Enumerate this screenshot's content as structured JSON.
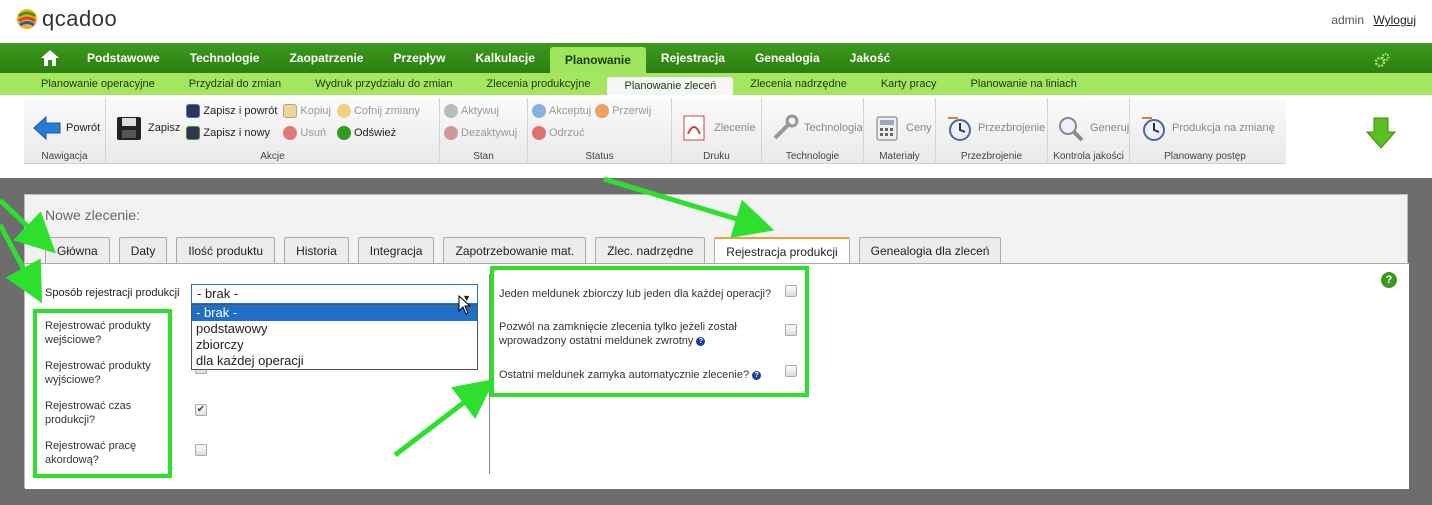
{
  "app": {
    "logo_text": "qcadoo",
    "user": "admin",
    "logout": "Wyloguj"
  },
  "main_menu": [
    "Podstawowe",
    "Technologie",
    "Zaopatrzenie",
    "Przepływ",
    "Kalkulacje",
    "Planowanie",
    "Rejestracja",
    "Genealogia",
    "Jakość"
  ],
  "main_menu_active": "Planowanie",
  "sub_menu": [
    "Planowanie operacyjne",
    "Przydział do zmian",
    "Wydruk przydziału do zmian",
    "Zlecenia produkcyjne",
    "Planowanie zleceń",
    "Zlecenia nadrzędne",
    "Karty pracy",
    "Planowanie na liniach"
  ],
  "sub_menu_active": "Planowanie zleceń",
  "ribbon": {
    "nav": {
      "back": "Powrót",
      "label": "Nawigacja"
    },
    "actions": {
      "save": "Zapisz",
      "save_back": "Zapisz i powrót",
      "save_new": "Zapisz i nowy",
      "copy": "Kopiuj",
      "delete": "Usuń",
      "undo": "Cofnij zmiany",
      "refresh": "Odśwież",
      "label": "Akcje"
    },
    "state": {
      "activate": "Aktywuj",
      "deactivate": "Dezaktywuj",
      "label": "Stan"
    },
    "status": {
      "accept": "Akceptuj",
      "interrupt": "Przerwij",
      "reject": "Odrzuć",
      "label": "Status"
    },
    "print": {
      "order": "Zlecenie",
      "label": "Druku"
    },
    "technology": {
      "btn": "Technologia",
      "label": "Technologie"
    },
    "materials": {
      "btn": "Ceny",
      "label": "Materiały"
    },
    "changeover": {
      "btn": "Przezbrojenie",
      "label": "Przezbrojenie"
    },
    "quality": {
      "btn": "Generuj",
      "label": "Kontrola jakości"
    },
    "planned": {
      "btn": "Produkcja na zmianę",
      "label": "Planowany postęp"
    }
  },
  "form": {
    "title": "Nowe zlecenie:",
    "tabs": [
      "Główna",
      "Daty",
      "Ilość produktu",
      "Historia",
      "Integracja",
      "Zapotrzebowanie mat.",
      "Zlec. nadrzędne",
      "Rejestracja produkcji",
      "Genealogia dla zleceń"
    ],
    "active_tab": "Rejestracja produkcji",
    "registration_label": "Sposób rejestracji produkcji",
    "registration_value": "- brak -",
    "registration_options": [
      "- brak -",
      "podstawowy",
      "zbiorczy",
      "dla każdej operacji"
    ],
    "left_checks": [
      {
        "l1": "Rejestrować produkty",
        "l2": "wejściowe?",
        "checked": false
      },
      {
        "l1": "Rejestrować produkty",
        "l2": "wyjściowe?",
        "checked": true
      },
      {
        "l1": "Rejestrować czas",
        "l2": "produkcji?",
        "checked": true
      },
      {
        "l1": "Rejestrować pracę",
        "l2": "akordową?",
        "checked": false
      }
    ],
    "right_checks": [
      {
        "l1": "Jeden meldunek zbiorczy lub jeden dla każdej operacji?",
        "l2": "",
        "checked": false
      },
      {
        "l1": "Pozwól na zamknięcie zlecenia tylko jeżeli został",
        "l2": "wprowadzony ostatni meldunek zwrotny",
        "checked": false
      },
      {
        "l1": "Ostatni meldunek zamyka automatycznie zlecenie?",
        "l2": "",
        "checked": false
      }
    ],
    "help": "?"
  },
  "colors": {
    "menu_green": "#3c9a1e",
    "submenu_green": "#a4e65f",
    "highlight": "#2ee02e",
    "select_blue": "#1e6fc8"
  }
}
